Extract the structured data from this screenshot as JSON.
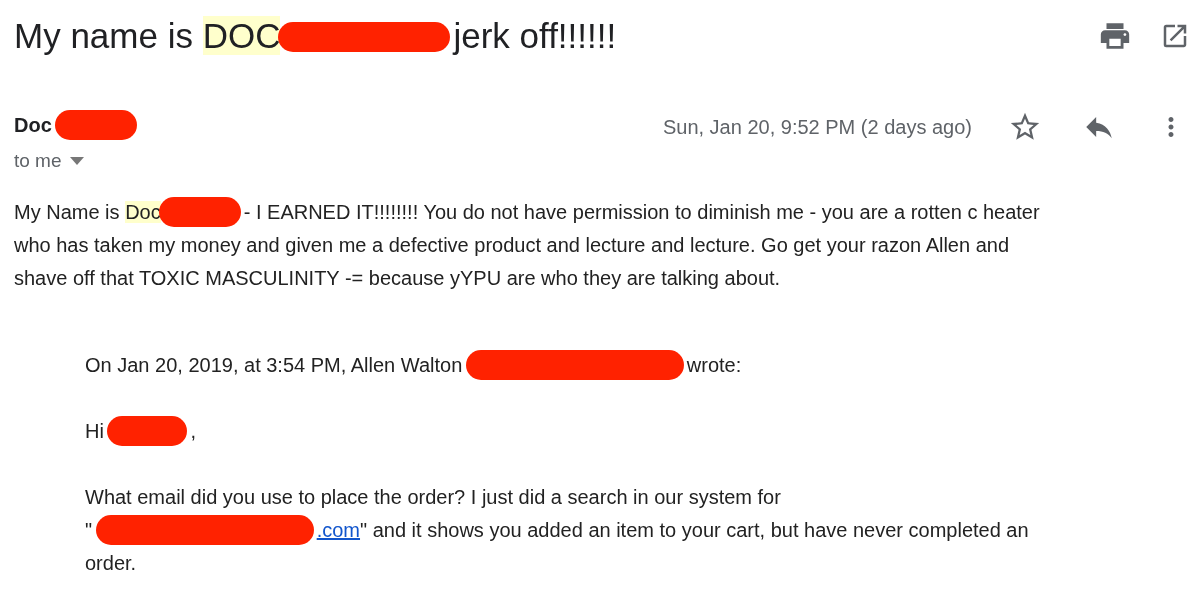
{
  "subject": {
    "parts": [
      {
        "kind": "text",
        "text": "My name is"
      },
      {
        "kind": "highlight",
        "text": "DOC"
      },
      {
        "kind": "redaction"
      },
      {
        "kind": "text",
        "text": "jerk off!!!!!!"
      }
    ]
  },
  "message": {
    "sender": [
      {
        "kind": "text",
        "text": "Doc"
      },
      {
        "kind": "redaction"
      }
    ],
    "date": "Sun, Jan 20, 9:52 PM (2 days ago)",
    "recipient": "to me",
    "body": [
      [
        {
          "kind": "text",
          "text": "My Name is"
        },
        {
          "kind": "highlight",
          "text": "Doc"
        },
        {
          "kind": "redaction"
        },
        {
          "kind": "text",
          "text": "- I EARNED IT!!!!!!!! You do not have permission to diminish me  - you are a rotten c heater"
        }
      ],
      [
        {
          "kind": "text",
          "text": "who has taken my money and given me a defective product and lecture and lecture. Go get your razon Allen and"
        }
      ],
      [
        {
          "kind": "text",
          "text": "shave off that TOXIC MASCULINITY -= because yYPU are who they are talking about."
        }
      ]
    ]
  },
  "quote": {
    "paragraphs": [
      [
        [
          {
            "kind": "text",
            "text": "On Jan 20, 2019, at 3:54 PM, Allen Walton"
          },
          {
            "kind": "redaction"
          },
          {
            "kind": "text",
            "text": "wrote:"
          }
        ]
      ],
      [
        [
          {
            "kind": "text",
            "text": "Hi"
          },
          {
            "kind": "redaction"
          },
          {
            "kind": "text",
            "text": ","
          }
        ]
      ],
      [
        [
          {
            "kind": "text",
            "text": "What email did you use to place the order? I just did a search in our system for"
          }
        ],
        [
          {
            "kind": "text",
            "text": "\""
          },
          {
            "kind": "redaction"
          },
          {
            "kind": "link",
            "text": ".com"
          },
          {
            "kind": "text",
            "text": "\" and it shows you added an item to your cart, but have never completed an"
          }
        ],
        [
          {
            "kind": "text",
            "text": "order."
          }
        ]
      ]
    ]
  }
}
